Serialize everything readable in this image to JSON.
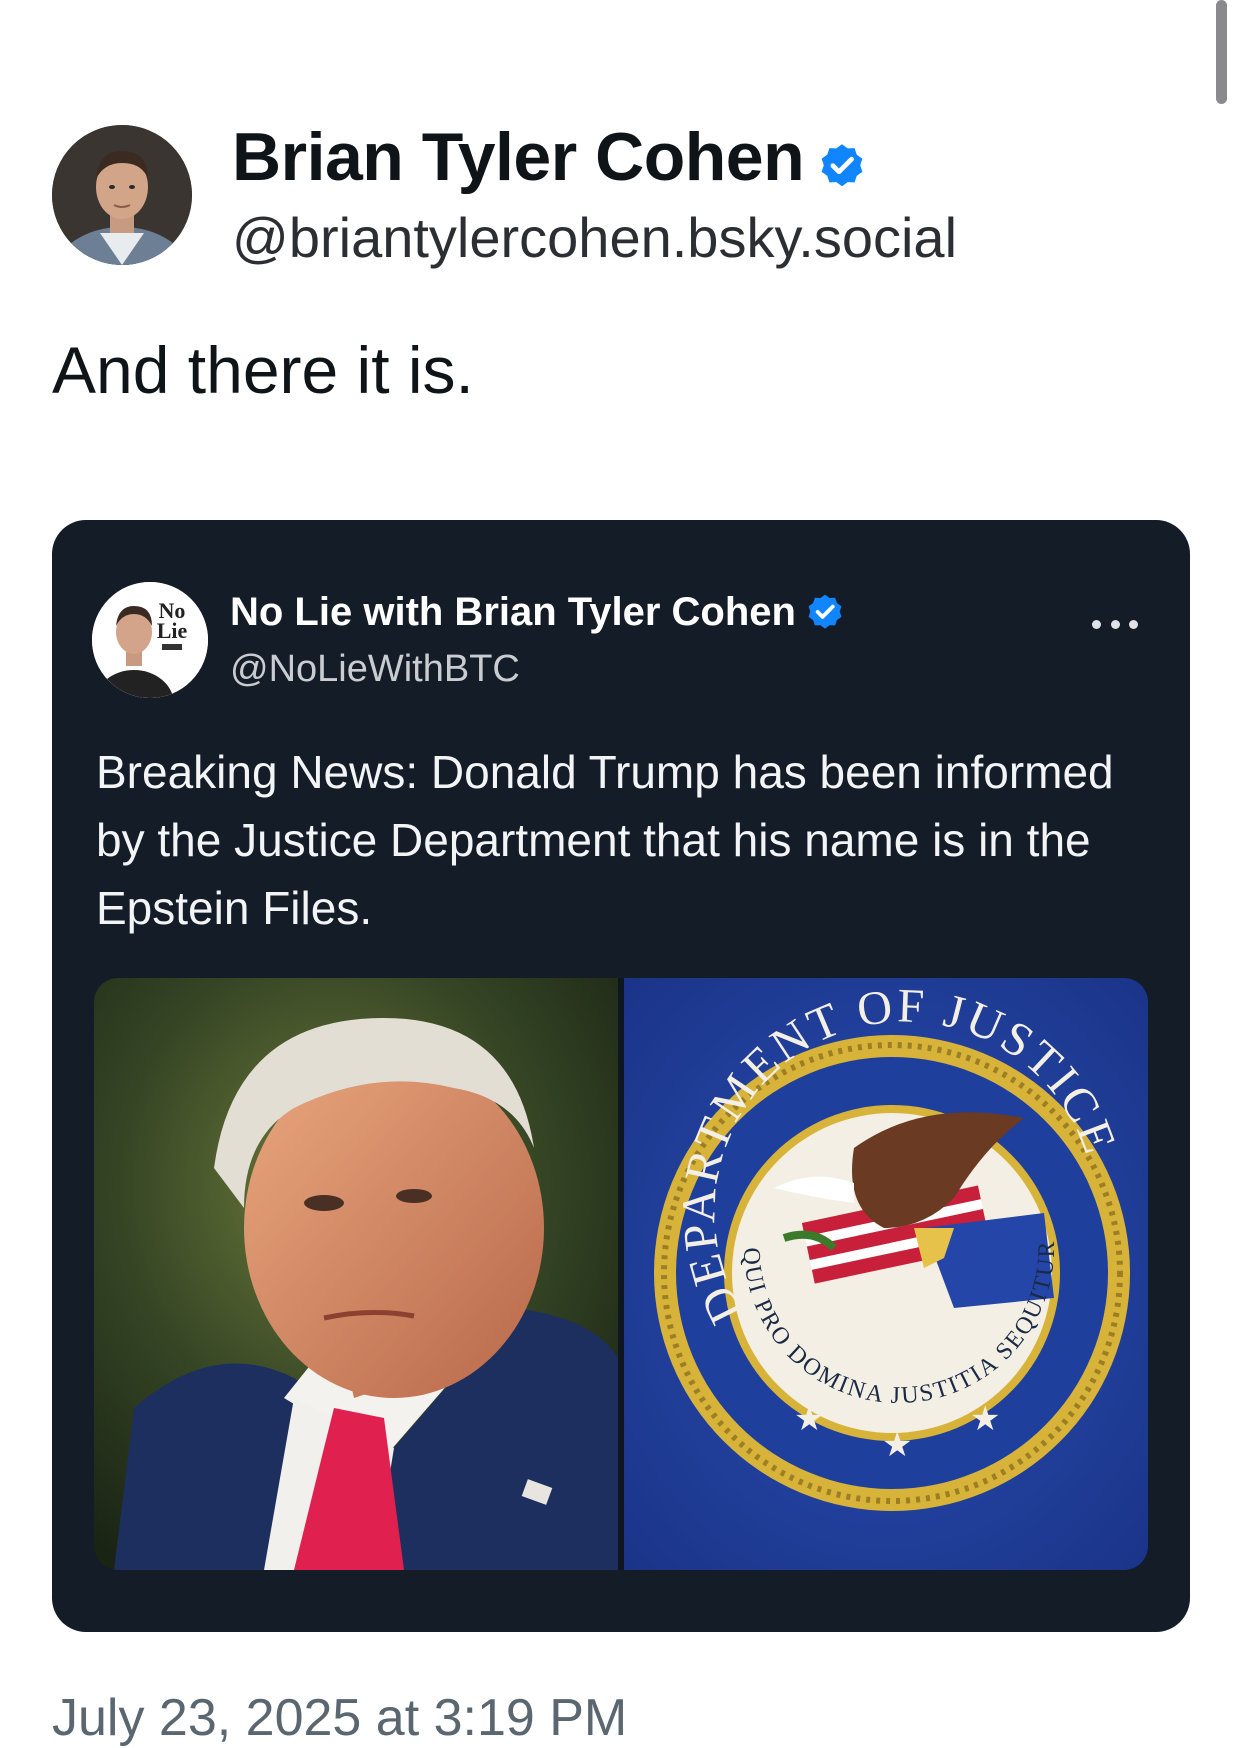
{
  "post": {
    "author": {
      "display_name": "Brian Tyler Cohen",
      "handle": "@briantylercohen.bsky.social",
      "verified": true
    },
    "text": "And there it is.",
    "timestamp": "July 23, 2025 at 3:19 PM"
  },
  "embedded_post": {
    "author": {
      "display_name": "No Lie with Brian Tyler Cohen",
      "handle": "@NoLieWithBTC",
      "verified": true,
      "logo_text_line1": "No",
      "logo_text_line2": "Lie"
    },
    "text": "Breaking News: Donald Trump has been informed by the Justice Department that his name is in the Epstein Files.",
    "media": {
      "left_image": "portrait-photo",
      "right_image": "department-of-justice-seal",
      "seal_text_outer": "DEPARTMENT OF JUSTICE",
      "seal_text_inner": "QUI PRO DOMINA JUSTITIA SEQUITUR"
    }
  },
  "colors": {
    "card_background": "#141c28",
    "verified_blue": "#1185fe",
    "seal_blue": "#1f3f9c",
    "seal_gold": "#d8b33a"
  },
  "icons": [
    "verified-badge-icon",
    "more-options-icon"
  ]
}
